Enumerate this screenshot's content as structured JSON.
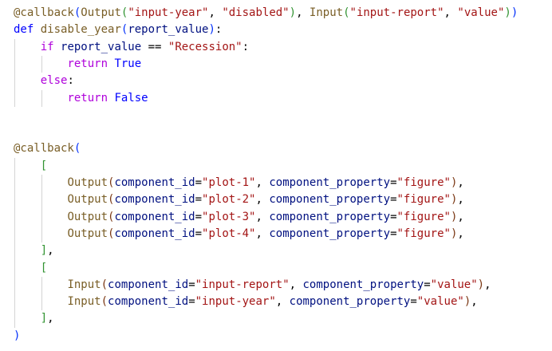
{
  "editor": {
    "language": "python",
    "colors": {
      "background": "#ffffff",
      "decorator": "#795e26",
      "function": "#795e26",
      "keyword": "#0000ff",
      "control_flow": "#af00db",
      "string": "#a31515",
      "parameter": "#001080",
      "bracket_level_1": "#0431fa",
      "bracket_level_2": "#319331",
      "bracket_level_3": "#7b3814",
      "indent_guide": "#d4d4d4"
    },
    "lines": [
      [
        [
          "tok-dec",
          "@callback"
        ],
        [
          "tok-br1",
          "("
        ],
        [
          "tok-fn",
          "Output"
        ],
        [
          "tok-br2",
          "("
        ],
        [
          "tok-str",
          "\"input-year\""
        ],
        [
          "tok-plain",
          ", "
        ],
        [
          "tok-str",
          "\"disabled\""
        ],
        [
          "tok-br2",
          ")"
        ],
        [
          "tok-plain",
          ", "
        ],
        [
          "tok-fn",
          "Input"
        ],
        [
          "tok-br2",
          "("
        ],
        [
          "tok-str",
          "\"input-report\""
        ],
        [
          "tok-plain",
          ", "
        ],
        [
          "tok-str",
          "\"value\""
        ],
        [
          "tok-br2",
          ")"
        ],
        [
          "tok-br1",
          ")"
        ]
      ],
      [
        [
          "tok-kw",
          "def"
        ],
        [
          "tok-plain",
          " "
        ],
        [
          "tok-fn",
          "disable_year"
        ],
        [
          "tok-br1",
          "("
        ],
        [
          "tok-param",
          "report_value"
        ],
        [
          "tok-br1",
          ")"
        ],
        [
          "tok-plain",
          ":"
        ]
      ],
      [
        [
          "tok-plain",
          "    "
        ],
        [
          "tok-flow",
          "if"
        ],
        [
          "tok-plain",
          " "
        ],
        [
          "tok-param",
          "report_value"
        ],
        [
          "tok-plain",
          " == "
        ],
        [
          "tok-str",
          "\"Recession\""
        ],
        [
          "tok-plain",
          ":"
        ]
      ],
      [
        [
          "tok-plain",
          "        "
        ],
        [
          "tok-flow",
          "return"
        ],
        [
          "tok-plain",
          " "
        ],
        [
          "tok-kw",
          "True"
        ]
      ],
      [
        [
          "tok-plain",
          "    "
        ],
        [
          "tok-flow",
          "else"
        ],
        [
          "tok-plain",
          ":"
        ]
      ],
      [
        [
          "tok-plain",
          "        "
        ],
        [
          "tok-flow",
          "return"
        ],
        [
          "tok-plain",
          " "
        ],
        [
          "tok-kw",
          "False"
        ]
      ],
      [],
      [],
      [
        [
          "tok-dec",
          "@callback"
        ],
        [
          "tok-br1",
          "("
        ]
      ],
      [
        [
          "tok-plain",
          "    "
        ],
        [
          "tok-br2",
          "["
        ]
      ],
      [
        [
          "tok-plain",
          "        "
        ],
        [
          "tok-fn",
          "Output"
        ],
        [
          "tok-br3",
          "("
        ],
        [
          "tok-param",
          "component_id"
        ],
        [
          "tok-plain",
          "="
        ],
        [
          "tok-str",
          "\"plot-1\""
        ],
        [
          "tok-plain",
          ", "
        ],
        [
          "tok-param",
          "component_property"
        ],
        [
          "tok-plain",
          "="
        ],
        [
          "tok-str",
          "\"figure\""
        ],
        [
          "tok-br3",
          ")"
        ],
        [
          "tok-plain",
          ","
        ]
      ],
      [
        [
          "tok-plain",
          "        "
        ],
        [
          "tok-fn",
          "Output"
        ],
        [
          "tok-br3",
          "("
        ],
        [
          "tok-param",
          "component_id"
        ],
        [
          "tok-plain",
          "="
        ],
        [
          "tok-str",
          "\"plot-2\""
        ],
        [
          "tok-plain",
          ", "
        ],
        [
          "tok-param",
          "component_property"
        ],
        [
          "tok-plain",
          "="
        ],
        [
          "tok-str",
          "\"figure\""
        ],
        [
          "tok-br3",
          ")"
        ],
        [
          "tok-plain",
          ","
        ]
      ],
      [
        [
          "tok-plain",
          "        "
        ],
        [
          "tok-fn",
          "Output"
        ],
        [
          "tok-br3",
          "("
        ],
        [
          "tok-param",
          "component_id"
        ],
        [
          "tok-plain",
          "="
        ],
        [
          "tok-str",
          "\"plot-3\""
        ],
        [
          "tok-plain",
          ", "
        ],
        [
          "tok-param",
          "component_property"
        ],
        [
          "tok-plain",
          "="
        ],
        [
          "tok-str",
          "\"figure\""
        ],
        [
          "tok-br3",
          ")"
        ],
        [
          "tok-plain",
          ","
        ]
      ],
      [
        [
          "tok-plain",
          "        "
        ],
        [
          "tok-fn",
          "Output"
        ],
        [
          "tok-br3",
          "("
        ],
        [
          "tok-param",
          "component_id"
        ],
        [
          "tok-plain",
          "="
        ],
        [
          "tok-str",
          "\"plot-4\""
        ],
        [
          "tok-plain",
          ", "
        ],
        [
          "tok-param",
          "component_property"
        ],
        [
          "tok-plain",
          "="
        ],
        [
          "tok-str",
          "\"figure\""
        ],
        [
          "tok-br3",
          ")"
        ],
        [
          "tok-plain",
          ","
        ]
      ],
      [
        [
          "tok-plain",
          "    "
        ],
        [
          "tok-br2",
          "]"
        ],
        [
          "tok-plain",
          ","
        ]
      ],
      [
        [
          "tok-plain",
          "    "
        ],
        [
          "tok-br2",
          "["
        ]
      ],
      [
        [
          "tok-plain",
          "        "
        ],
        [
          "tok-fn",
          "Input"
        ],
        [
          "tok-br3",
          "("
        ],
        [
          "tok-param",
          "component_id"
        ],
        [
          "tok-plain",
          "="
        ],
        [
          "tok-str",
          "\"input-report\""
        ],
        [
          "tok-plain",
          ", "
        ],
        [
          "tok-param",
          "component_property"
        ],
        [
          "tok-plain",
          "="
        ],
        [
          "tok-str",
          "\"value\""
        ],
        [
          "tok-br3",
          ")"
        ],
        [
          "tok-plain",
          ","
        ]
      ],
      [
        [
          "tok-plain",
          "        "
        ],
        [
          "tok-fn",
          "Input"
        ],
        [
          "tok-br3",
          "("
        ],
        [
          "tok-param",
          "component_id"
        ],
        [
          "tok-plain",
          "="
        ],
        [
          "tok-str",
          "\"input-year\""
        ],
        [
          "tok-plain",
          ", "
        ],
        [
          "tok-param",
          "component_property"
        ],
        [
          "tok-plain",
          "="
        ],
        [
          "tok-str",
          "\"value\""
        ],
        [
          "tok-br3",
          ")"
        ],
        [
          "tok-plain",
          ","
        ]
      ],
      [
        [
          "tok-plain",
          "    "
        ],
        [
          "tok-br2",
          "]"
        ],
        [
          "tok-plain",
          ","
        ]
      ],
      [
        [
          "tok-br1",
          ")"
        ]
      ]
    ]
  }
}
